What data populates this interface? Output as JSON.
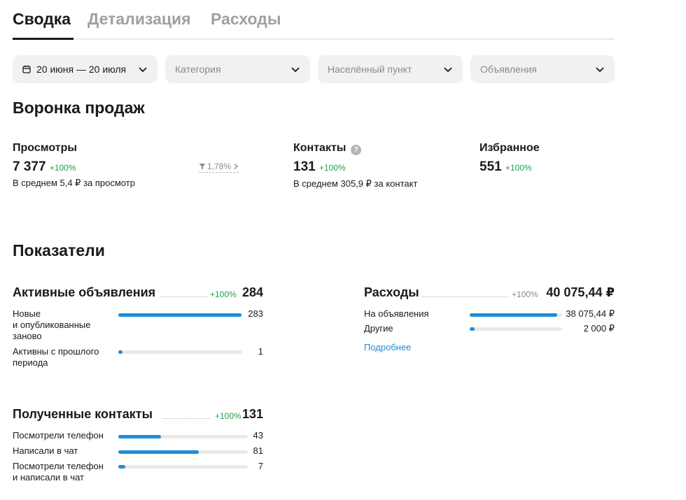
{
  "tabs": [
    {
      "label": "Сводка",
      "active": true
    },
    {
      "label": "Детализация",
      "active": false
    },
    {
      "label": "Расходы",
      "active": false
    }
  ],
  "filters": {
    "date": "20 июня — 20 июля",
    "category": "Категория",
    "locality": "Населённый пункт",
    "ads": "Объявления"
  },
  "funnel": {
    "title": "Воронка продаж",
    "views": {
      "label": "Просмотры",
      "value": "7 377",
      "change": "+100%",
      "sub": "В среднем 5,4 ₽ за просмотр",
      "conversion": "1,78%"
    },
    "contacts": {
      "label": "Контакты",
      "value": "131",
      "change": "+100%",
      "sub": "В среднем 305,9 ₽ за контакт",
      "help": "?"
    },
    "favorites": {
      "label": "Избранное",
      "value": "551",
      "change": "+100%"
    }
  },
  "indicators": {
    "title": "Показатели",
    "active_ads": {
      "title": "Активные объявления",
      "change": "+100%",
      "total": "284",
      "rows": [
        {
          "label": "Новые\nи опубликованные\nзаново",
          "value": "283",
          "fraction": 0.996
        },
        {
          "label": "Активны с прошлого\nпериода",
          "value": "1",
          "fraction": 0.035
        }
      ]
    },
    "expenses": {
      "title": "Расходы",
      "change": "+100%",
      "total": "40 075,44 ₽",
      "rows": [
        {
          "label": "На объявления",
          "value": "38 075,44 ₽",
          "fraction": 0.95
        },
        {
          "label": "Другие",
          "value": "2 000 ₽",
          "fraction": 0.05
        }
      ],
      "more_link": "Подробнее"
    },
    "received_contacts": {
      "title": "Полученные контакты",
      "change": "+100%",
      "total": "131",
      "rows": [
        {
          "label": "Посмотрели телефон",
          "value": "43",
          "fraction": 0.33
        },
        {
          "label": "Написали в чат",
          "value": "81",
          "fraction": 0.62
        },
        {
          "label": "Посмотрели телефон\nи написали в чат",
          "value": "7",
          "fraction": 0.053
        }
      ]
    }
  },
  "colors": {
    "accent": "#1a8ed8",
    "positive": "#1fa34a",
    "muted": "#8a8a8a"
  }
}
